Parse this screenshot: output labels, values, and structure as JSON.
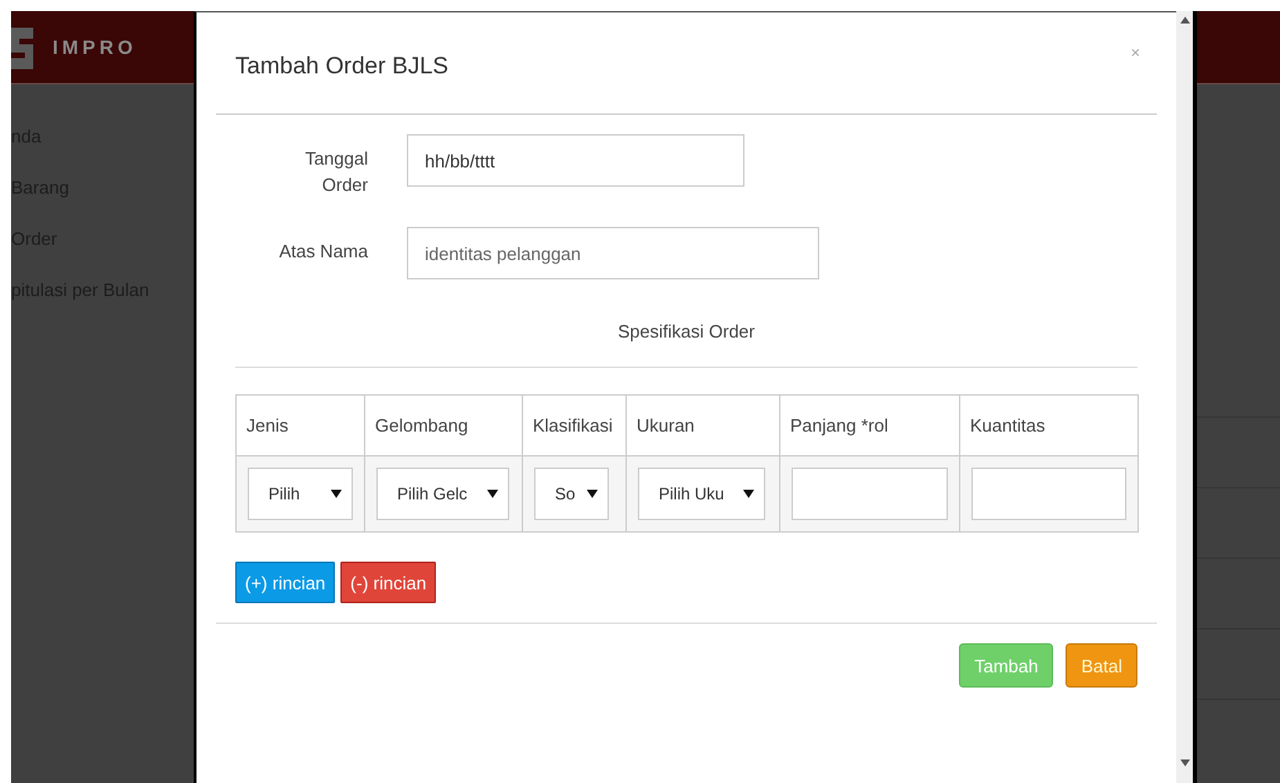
{
  "app": {
    "logo": "IMPRO"
  },
  "sidebar": {
    "items": [
      "nda",
      "Barang",
      "Order",
      "pitulasi per Bulan"
    ]
  },
  "modal": {
    "title": "Tambah Order BJLS",
    "close": "×",
    "fields": [
      {
        "label": "Tanggal Order",
        "value": "hh/bb/tttt",
        "kind": "date"
      },
      {
        "label": "Atas Nama",
        "placeholder": "identitas pelanggan",
        "kind": "text"
      }
    ],
    "section_title": "Spesifikasi Order",
    "table": {
      "columns": [
        "Jenis",
        "Gelombang",
        "Klasifikasi",
        "Ukuran",
        "Panjang *rol",
        "Kuantitas"
      ],
      "rows": [
        [
          {
            "kind": "select",
            "value": "Pilih"
          },
          {
            "kind": "select",
            "value": "Pilih Gelc"
          },
          {
            "kind": "select",
            "value": "So"
          },
          {
            "kind": "select",
            "value": "Pilih Uku"
          },
          {
            "kind": "input"
          },
          {
            "kind": "input"
          }
        ]
      ]
    },
    "row_buttons": [
      {
        "label": "(+) rincian",
        "kind": "add"
      },
      {
        "label": "(-) rincian",
        "kind": "remove"
      }
    ],
    "footer_buttons": [
      {
        "label": "Tambah",
        "kind": "submit"
      },
      {
        "label": "Batal",
        "kind": "cancel"
      }
    ]
  }
}
